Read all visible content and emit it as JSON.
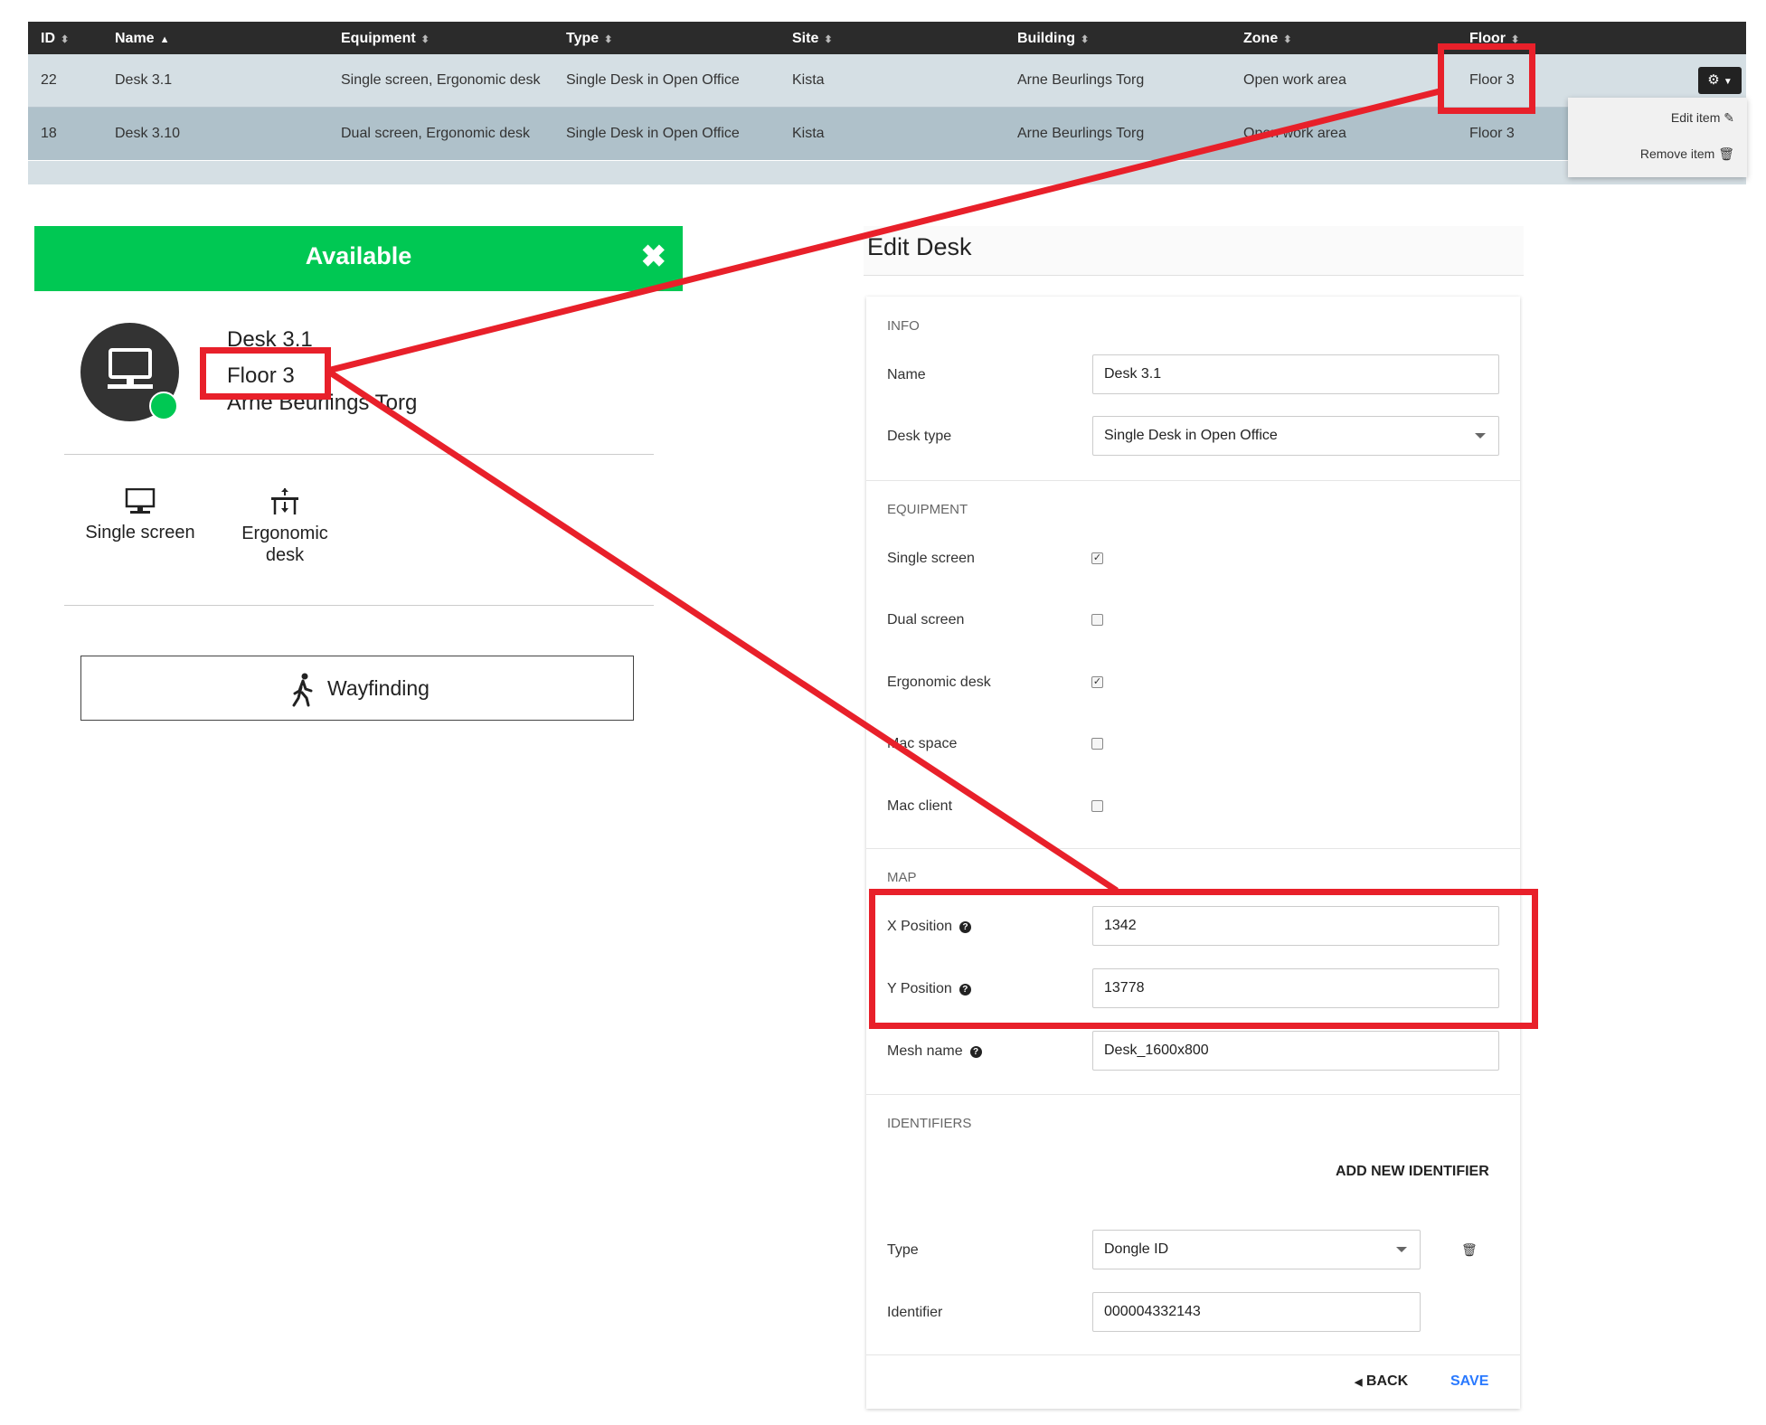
{
  "table": {
    "headers": [
      "ID",
      "Name",
      "Equipment",
      "Type",
      "Site",
      "Building",
      "Zone",
      "Floor"
    ],
    "rows": [
      [
        "22",
        "Desk 3.1",
        "Single screen, Ergonomic desk",
        "Single Desk in Open Office",
        "Kista",
        "Arne Beurlings Torg",
        "Open work area",
        "Floor 3"
      ],
      [
        "18",
        "Desk 3.10",
        "Dual screen, Ergonomic desk",
        "Single Desk in Open Office",
        "Kista",
        "Arne Beurlings Torg",
        "Open work area",
        "Floor 3"
      ]
    ],
    "row_menu": {
      "edit": "Edit item",
      "remove": "Remove item"
    }
  },
  "desk_card": {
    "status": "Available",
    "name": "Desk 3.1",
    "floor": "Floor 3",
    "building": "Arne Beurlings Torg",
    "equipment": [
      "Single screen",
      "Ergonomic desk"
    ],
    "wayfinding": "Wayfinding"
  },
  "edit_desk": {
    "title": "Edit Desk",
    "info_section": "INFO",
    "name_label": "Name",
    "name_value": "Desk 3.1",
    "type_label": "Desk type",
    "type_value": "Single Desk in Open Office",
    "equipment_section": "EQUIPMENT",
    "equipment": [
      {
        "label": "Single screen",
        "checked": true
      },
      {
        "label": "Dual screen",
        "checked": false
      },
      {
        "label": "Ergonomic desk",
        "checked": true
      },
      {
        "label": "Mac space",
        "checked": false
      },
      {
        "label": "Mac client",
        "checked": false
      }
    ],
    "map_section": "MAP",
    "x_label": "X Position",
    "x_value": "1342",
    "y_label": "Y Position",
    "y_value": "13778",
    "mesh_label": "Mesh name",
    "mesh_value": "Desk_1600x800",
    "identifiers_section": "IDENTIFIERS",
    "add_identifier": "ADD NEW IDENTIFIER",
    "id_type_label": "Type",
    "id_type_value": "Dongle ID",
    "identifier_label": "Identifier",
    "identifier_value": "000004332143",
    "back": "BACK",
    "save": "SAVE"
  },
  "colors": {
    "available": "#00c853",
    "annotation": "#e8202a",
    "save": "#2979ff",
    "header": "#2b2b2b"
  }
}
